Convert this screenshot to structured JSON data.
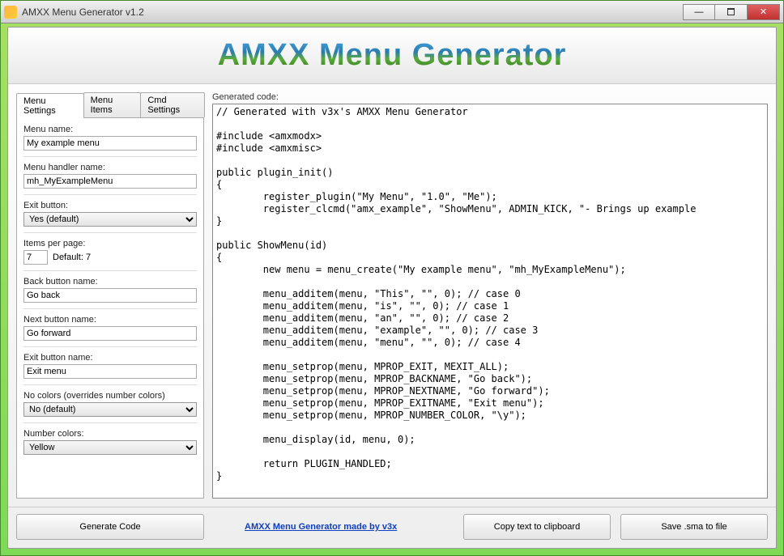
{
  "window": {
    "title": "AMXX Menu Generator v1.2"
  },
  "banner": {
    "text": "AMXX Menu Generator"
  },
  "tabs": {
    "settings": "Menu Settings",
    "items": "Menu Items",
    "cmd": "Cmd Settings"
  },
  "form": {
    "menu_name_label": "Menu name:",
    "menu_name_value": "My example menu",
    "handler_label": "Menu handler name:",
    "handler_value": "mh_MyExampleMenu",
    "exit_label": "Exit button:",
    "exit_value": "Yes (default)",
    "items_label": "Items per page:",
    "items_value": "7",
    "items_default": "Default: 7",
    "back_label": "Back button name:",
    "back_value": "Go back",
    "next_label": "Next button name:",
    "next_value": "Go forward",
    "exitname_label": "Exit button name:",
    "exitname_value": "Exit menu",
    "nocolors_label": "No colors (overrides number colors)",
    "nocolors_value": "No (default)",
    "numcolors_label": "Number colors:",
    "numcolors_value": "Yellow"
  },
  "right": {
    "label": "Generated code:",
    "code": "// Generated with v3x's AMXX Menu Generator\n\n#include <amxmodx>\n#include <amxmisc>\n\npublic plugin_init()\n{\n        register_plugin(\"My Menu\", \"1.0\", \"Me\");\n        register_clcmd(\"amx_example\", \"ShowMenu\", ADMIN_KICK, \"- Brings up example\n}\n\npublic ShowMenu(id)\n{\n        new menu = menu_create(\"My example menu\", \"mh_MyExampleMenu\");\n\n        menu_additem(menu, \"This\", \"\", 0); // case 0\n        menu_additem(menu, \"is\", \"\", 0); // case 1\n        menu_additem(menu, \"an\", \"\", 0); // case 2\n        menu_additem(menu, \"example\", \"\", 0); // case 3\n        menu_additem(menu, \"menu\", \"\", 0); // case 4\n\n        menu_setprop(menu, MPROP_EXIT, MEXIT_ALL);\n        menu_setprop(menu, MPROP_BACKNAME, \"Go back\");\n        menu_setprop(menu, MPROP_NEXTNAME, \"Go forward\");\n        menu_setprop(menu, MPROP_EXITNAME, \"Exit menu\");\n        menu_setprop(menu, MPROP_NUMBER_COLOR, \"\\y\");\n\n        menu_display(id, menu, 0);\n\n        return PLUGIN_HANDLED;\n}"
  },
  "buttons": {
    "generate": "Generate Code",
    "credit": "AMXX Menu Generator made by v3x",
    "copy": "Copy text to clipboard",
    "save": "Save .sma to file"
  }
}
